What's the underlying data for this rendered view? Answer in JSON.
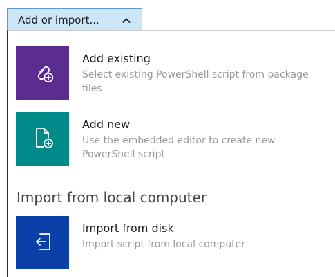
{
  "toggle": {
    "label": "Add or import...",
    "chevron_icon": "chevron-up-icon"
  },
  "items": [
    {
      "title": "Add existing",
      "description": "Select existing PowerShell script from package files",
      "icon": "link-add-icon",
      "tile_color": "#5c2d91"
    },
    {
      "title": "Add new",
      "description": "Use the embedded editor to create new PowerShell script",
      "icon": "new-document-icon",
      "tile_color": "#008b8b"
    }
  ],
  "import_section": {
    "heading": "Import from local computer",
    "items": [
      {
        "title": "Import from disk",
        "description": "Import script from local computer",
        "icon": "import-icon",
        "tile_color": "#0c3fa8"
      }
    ]
  }
}
